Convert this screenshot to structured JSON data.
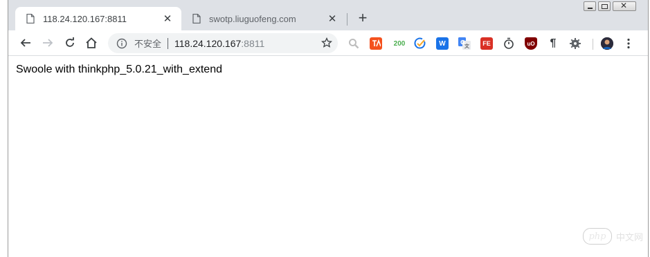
{
  "tabs": [
    {
      "title": "118.24.120.167:8811",
      "active": true,
      "close": "✕"
    },
    {
      "title": "swotp.liuguofeng.com",
      "active": false,
      "close": "✕"
    }
  ],
  "new_tab_label": "+",
  "omnibox": {
    "security_text": "不安全",
    "host": "118.24.120.167",
    "port": ":8811"
  },
  "extensions": [
    {
      "name": "search-extension-icon",
      "label": "",
      "color": "#bdbdbd"
    },
    {
      "name": "translate-extension-icon",
      "label": "",
      "color": "#f4511e"
    },
    {
      "name": "status-200-extension-icon",
      "label": "200",
      "color": "#ffffff"
    },
    {
      "name": "check-extension-icon",
      "label": "",
      "color": "#ffffff"
    },
    {
      "name": "w-extension-icon",
      "label": "W",
      "color": "#1a73e8"
    },
    {
      "name": "google-translate-extension-icon",
      "label": "",
      "color": "#4285f4"
    },
    {
      "name": "fe-extension-icon",
      "label": "FE",
      "color": "#d93025"
    },
    {
      "name": "timer-extension-icon",
      "label": "",
      "color": "#ffffff"
    },
    {
      "name": "ublock-extension-icon",
      "label": "uO",
      "color": "#800000"
    },
    {
      "name": "pilcrow-extension-icon",
      "label": "¶",
      "color": "#ffffff"
    },
    {
      "name": "gear-extension-icon",
      "label": "",
      "color": "#ffffff"
    }
  ],
  "page": {
    "text": "Swoole with thinkphp_5.0.21_with_extend"
  },
  "watermark": {
    "logo": "php",
    "text": "中文网"
  }
}
